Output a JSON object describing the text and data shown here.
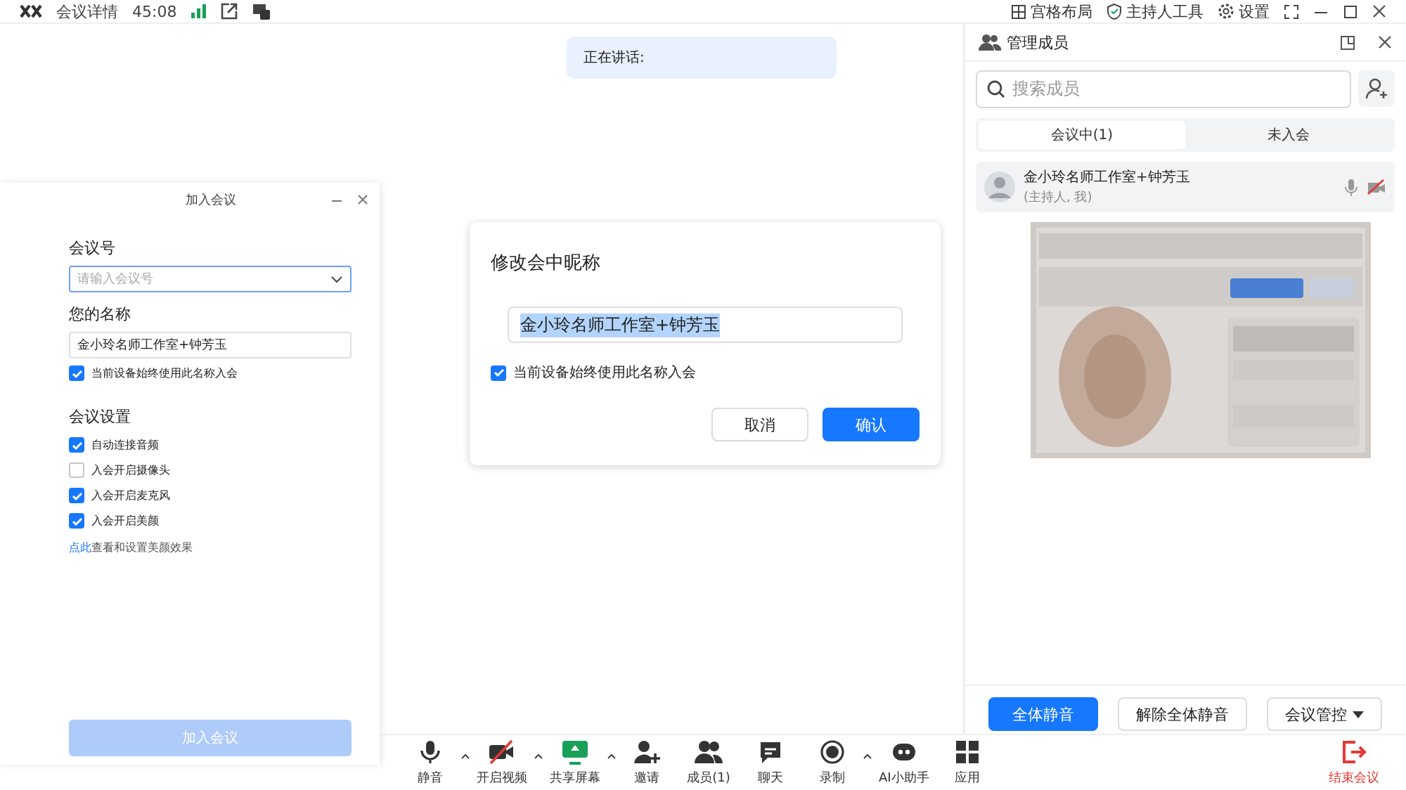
{
  "top_bar": {
    "meeting_info": "会议详情",
    "timer": "45:08",
    "layout": "宫格布局",
    "host_tools": "主持人工具",
    "settings": "设置"
  },
  "speaking": {
    "label": "正在讲话:"
  },
  "join_dialog": {
    "title": "加入会议",
    "meeting_number": {
      "label": "会议号",
      "placeholder": "请输入会议号"
    },
    "name": {
      "label": "您的名称",
      "value": "金小玲名师工作室+钟芳玉"
    },
    "remember_name": {
      "label": "当前设备始终使用此名称入会",
      "checked": true
    },
    "settings_title": "会议设置",
    "settings": [
      {
        "label": "自动连接音频",
        "checked": true
      },
      {
        "label": "入会开启摄像头",
        "checked": false
      },
      {
        "label": "入会开启麦克风",
        "checked": true
      },
      {
        "label": "入会开启美颜",
        "checked": true
      }
    ],
    "beauty_link": {
      "link": "点此",
      "text": "查看和设置美颜效果"
    },
    "join_button": {
      "label": "加入会议",
      "disabled": true
    }
  },
  "nickname_dialog": {
    "title": "修改会中昵称",
    "value": "金小玲名师工作室+钟芳玉",
    "remember": {
      "label": "当前设备始终使用此名称入会",
      "checked": true
    },
    "buttons": [
      {
        "label": "取消",
        "kind": "secondary"
      },
      {
        "label": "确认",
        "kind": "primary"
      }
    ]
  },
  "members_panel": {
    "title": "管理成员",
    "search": {
      "placeholder": "搜索成员"
    },
    "tabs": [
      {
        "label": "会议中(1)",
        "selected": true
      },
      {
        "label": "未入会",
        "selected": false
      }
    ],
    "members": [
      {
        "name": "金小玲名师工作室+钟芳玉",
        "role": "(主持人, 我)",
        "video_on": false
      }
    ],
    "buttons": [
      {
        "label": "全体静音",
        "kind": "primary"
      },
      {
        "label": "解除全体静音",
        "kind": "secondary"
      },
      {
        "label": "会议管控",
        "kind": "dropdown"
      }
    ]
  },
  "toolbar": [
    {
      "label": "静音",
      "kind": "mic",
      "caret": true
    },
    {
      "label": "开启视频",
      "kind": "video-off",
      "caret": true
    },
    {
      "label": "共享屏幕",
      "kind": "share",
      "caret": true
    },
    {
      "label": "邀请",
      "kind": "invite",
      "caret": false
    },
    {
      "label": "成员(1)",
      "kind": "members",
      "caret": false
    },
    {
      "label": "聊天",
      "kind": "chat",
      "caret": false
    },
    {
      "label": "录制",
      "kind": "record",
      "caret": true
    },
    {
      "label": "AI小助手",
      "kind": "ai",
      "caret": false
    },
    {
      "label": "应用",
      "kind": "apps",
      "caret": false
    }
  ],
  "end_meeting": {
    "label": "结束会议"
  }
}
